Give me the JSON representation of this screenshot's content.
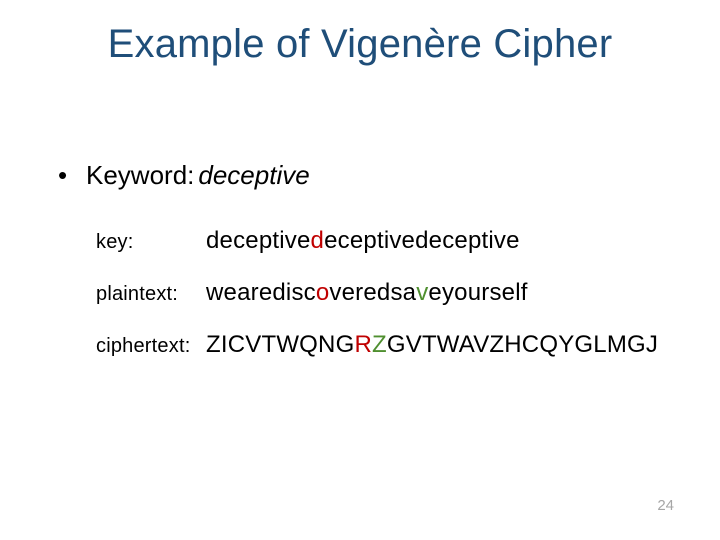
{
  "title": "Example of Vigenère Cipher",
  "bullet": {
    "label": "Keyword:",
    "value": "deceptive"
  },
  "rows": {
    "key": {
      "label": "key:",
      "segments": [
        {
          "text": "deceptive",
          "cls": ""
        },
        {
          "text": "d",
          "cls": "hl-red"
        },
        {
          "text": "eceptivedeceptive",
          "cls": ""
        }
      ]
    },
    "plaintext": {
      "label": "plaintext:",
      "segments": [
        {
          "text": "wearedisc",
          "cls": ""
        },
        {
          "text": "o",
          "cls": "hl-red"
        },
        {
          "text": "veredsa",
          "cls": ""
        },
        {
          "text": "v",
          "cls": "hl-green"
        },
        {
          "text": "eyourself",
          "cls": ""
        }
      ]
    },
    "ciphertext": {
      "label": "ciphertext:",
      "segments": [
        {
          "text": "ZICVTWQNG",
          "cls": ""
        },
        {
          "text": "R",
          "cls": "hl-red"
        },
        {
          "text": "Z",
          "cls": "hl-green"
        },
        {
          "text": "GVTWAVZHCQYGLMGJ",
          "cls": ""
        }
      ]
    }
  },
  "page_number": "24"
}
